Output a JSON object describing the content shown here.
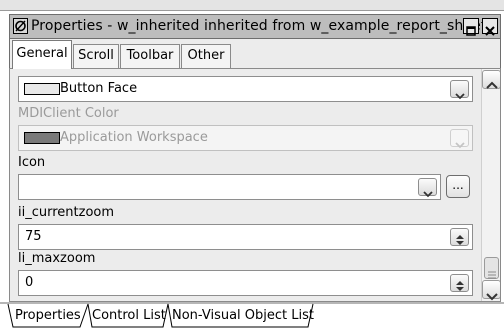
{
  "window": {
    "title": "Properties -  w_inherited  inherited  from  w_example_report_sheet",
    "restore_icon": "restore-icon",
    "close_icon": "close-icon"
  },
  "tabs": [
    {
      "label": "General",
      "active": true
    },
    {
      "label": "Scroll",
      "active": false
    },
    {
      "label": "Toolbar",
      "active": false
    },
    {
      "label": "Other",
      "active": false
    }
  ],
  "properties": {
    "color_field": {
      "value": "Button Face",
      "swatch_color": "#e9e9e9"
    },
    "mdiclient_color": {
      "label": "MDIClient Color",
      "value": "Application Workspace",
      "swatch_color": "#7a7a7a",
      "disabled": true
    },
    "icon": {
      "label": "Icon",
      "value": "",
      "browse_label": "..."
    },
    "ii_currentzoom": {
      "label": "ii_currentzoom",
      "value": "75"
    },
    "li_maxzoom": {
      "label": "li_maxzoom",
      "value": "0"
    }
  },
  "bottom_tabs": [
    {
      "label": "Properties",
      "active": true
    },
    {
      "label": "Control List",
      "active": false
    },
    {
      "label": "Non-Visual Object List",
      "active": false
    }
  ]
}
